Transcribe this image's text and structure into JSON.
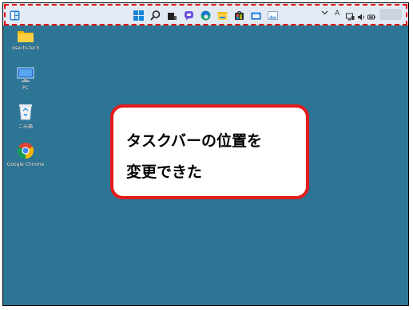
{
  "taskbar": {
    "icons": [
      "widgets-icon",
      "start-icon",
      "search-icon",
      "task-view-icon",
      "chat-icon",
      "edge-icon",
      "file-explorer-icon",
      "store-icon",
      "mail-icon",
      "photos-icon"
    ],
    "tray": {
      "chevron": "^",
      "ime": "A"
    }
  },
  "desktop": {
    "icons": [
      {
        "label": "osechi-tech",
        "icon": "folder-icon"
      },
      {
        "label": "PC",
        "icon": "pc-icon"
      },
      {
        "label": "ごみ箱",
        "icon": "recycle-bin-icon"
      },
      {
        "label": "Google Chrome",
        "icon": "chrome-icon"
      }
    ]
  },
  "callout": {
    "line1": "タスクバーの位置を",
    "line2": "変更できた"
  },
  "colors": {
    "desktop": "#2d7595",
    "taskbar": "#e3eaf4",
    "highlight": "#e01010",
    "callout_border": "#e41b1b"
  }
}
